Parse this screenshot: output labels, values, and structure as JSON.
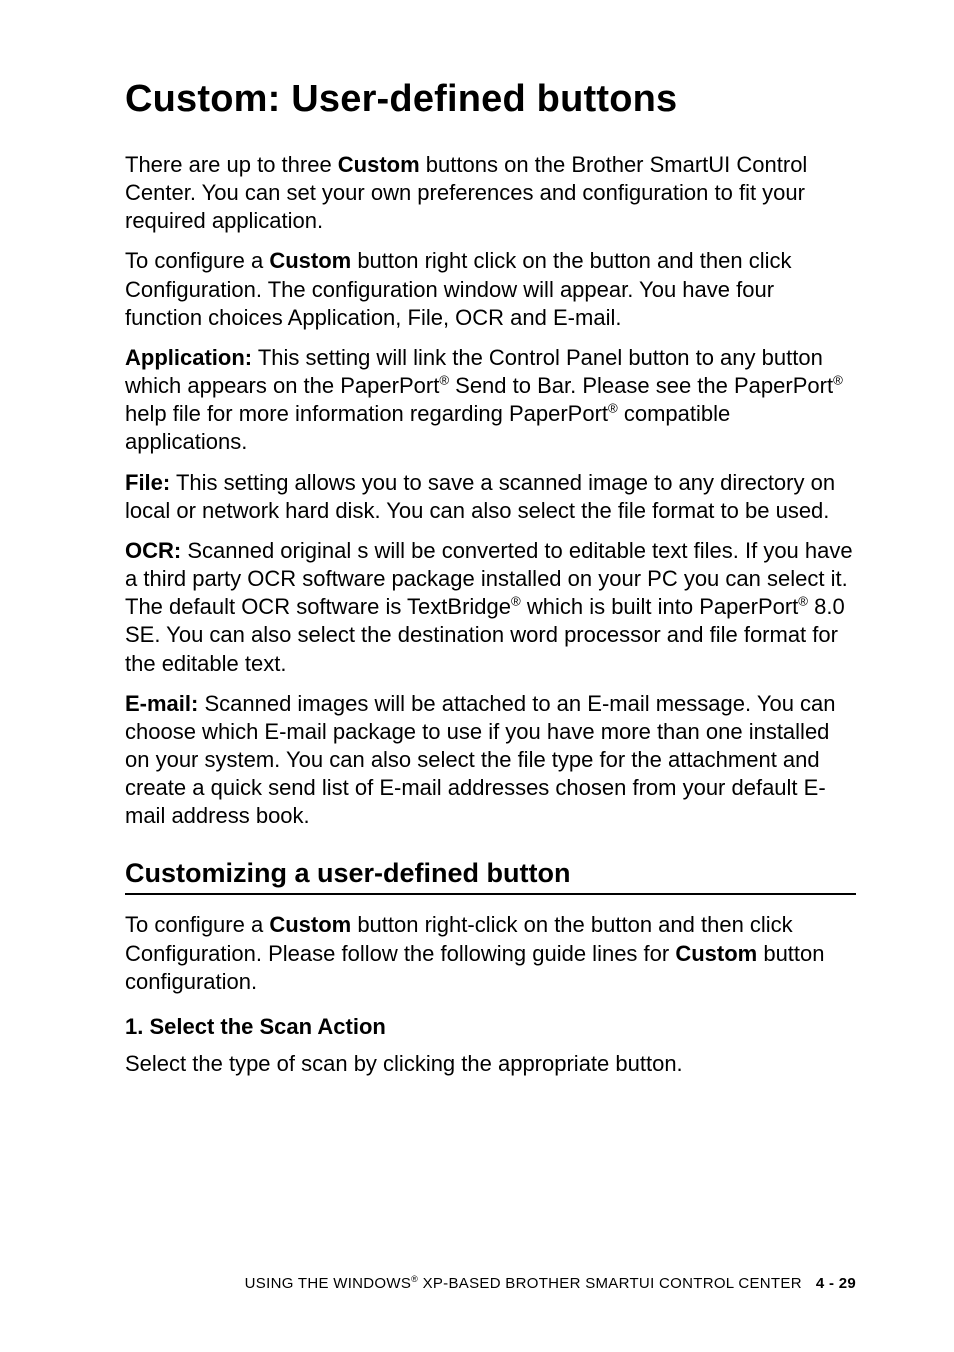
{
  "title": "Custom: User-defined buttons",
  "p1": {
    "a": "There are up to three ",
    "b": "Custom",
    "c": " buttons on the Brother SmartUI Control Center. You can set your own preferences and configuration to fit your required application."
  },
  "p2": {
    "a": "To configure a ",
    "b": "Custom",
    "c": " button right click on the button and then click Configuration. The configuration window will appear. You have four function choices Application, File, OCR and E-mail."
  },
  "p3": {
    "label": "Application:",
    "a": "  This setting will link the Control Panel button to any button which appears on the PaperPort",
    "b": " Send to Bar. Please see the PaperPort",
    "c": " help file for more information regarding PaperPort",
    "d": " compatible applications."
  },
  "p4": {
    "label": "File:",
    "text": "  This setting allows you to save a scanned image to any directory on local or network hard disk. You can also select the file format to be used."
  },
  "p5": {
    "label": "OCR:",
    "a": "  Scanned original s will be converted to editable text files. If you have a third party OCR software package installed on your PC you can select it. The default OCR software is TextBridge",
    "b": " which is built into PaperPort",
    "c": " 8.0 SE. You can also select the destination word processor and file format for the editable text."
  },
  "p6": {
    "label": "E-mail:",
    "text": "  Scanned images will be attached to an E-mail message. You can choose which E-mail package to use if you have more than one installed on your system. You can also select the file type for the attachment and create a quick send list of E-mail addresses chosen from your default E-mail address book."
  },
  "section": "Customizing a user-defined button",
  "p7": {
    "a": "To configure a ",
    "b": "Custom",
    "c": " button right-click on the button and then click Configuration. Please follow the following guide lines for ",
    "d": "Custom",
    "e": " button configuration."
  },
  "subhead": "1. Select the Scan Action",
  "p8": "Select the type of scan by clicking the appropriate button.",
  "reg": "®",
  "footer": {
    "a": "USING THE WINDOWS",
    "b": " XP-BASED BROTHER SMARTUI CONTROL CENTER",
    "page": "4 - 29"
  }
}
